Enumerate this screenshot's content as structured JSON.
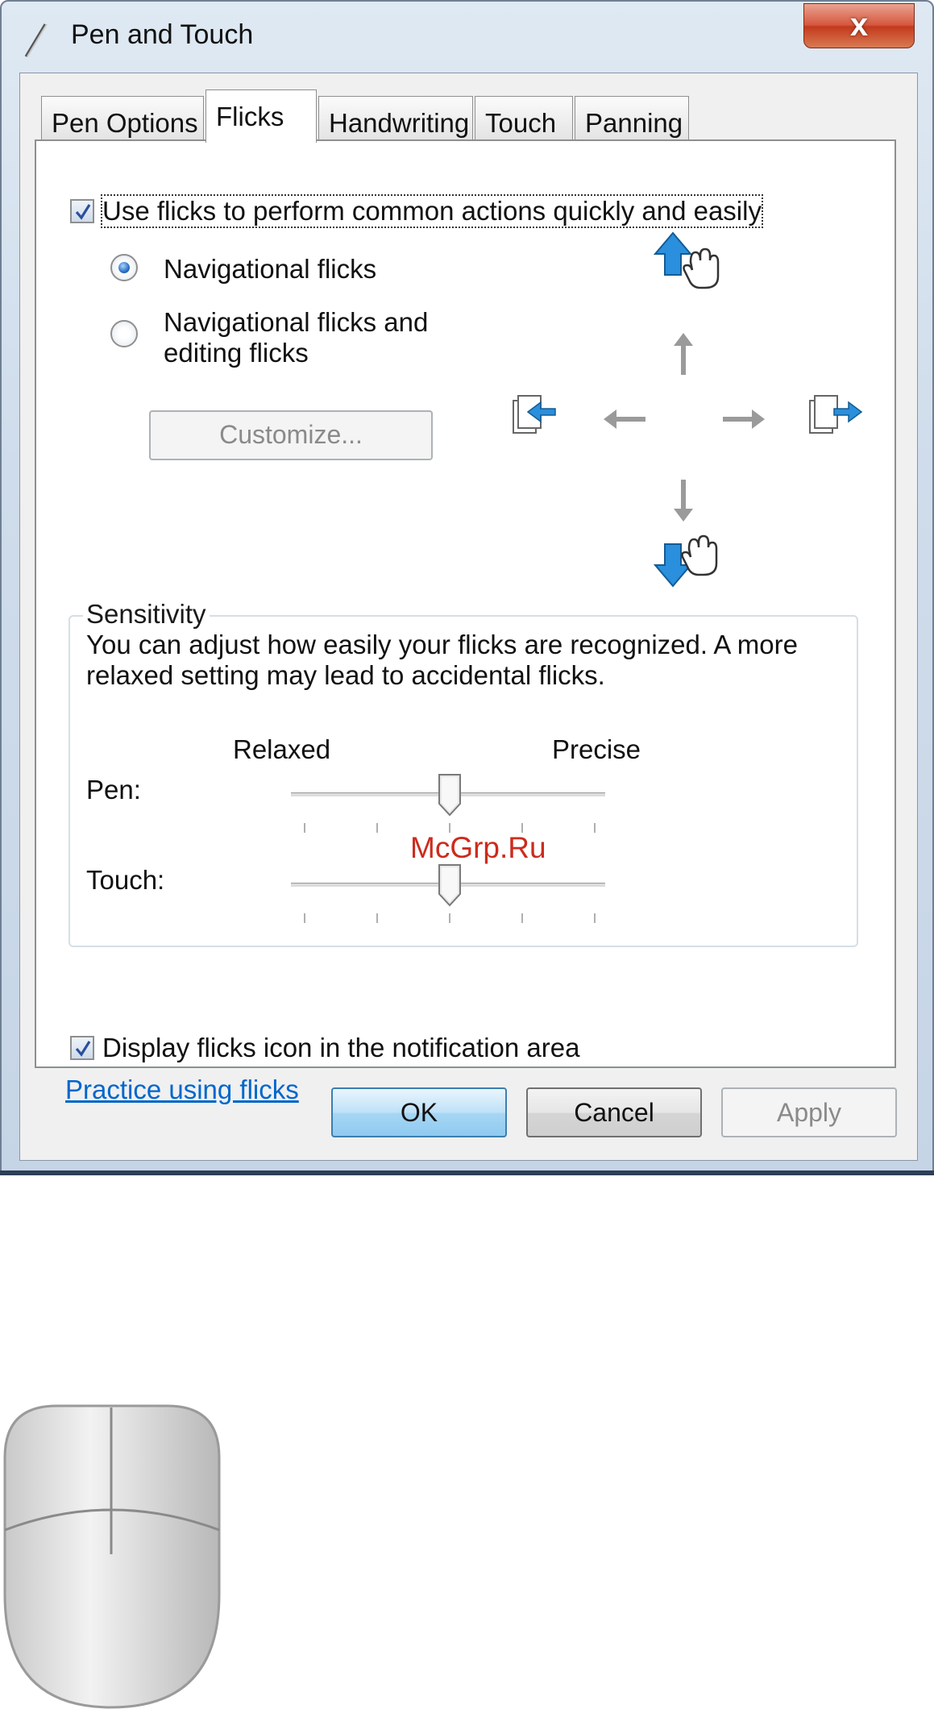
{
  "window": {
    "title": "Pen and Touch",
    "close_label": "x"
  },
  "tabs": [
    {
      "label": "Pen Options",
      "active": false
    },
    {
      "label": "Flicks",
      "active": true
    },
    {
      "label": "Handwriting",
      "active": false
    },
    {
      "label": "Touch",
      "active": false
    },
    {
      "label": "Panning",
      "active": false
    }
  ],
  "flicks": {
    "use_flicks": {
      "label": "Use flicks to perform common actions quickly and easily",
      "checked": true
    },
    "navigational": {
      "label": "Navigational flicks",
      "selected": true
    },
    "nav_editing": {
      "label_line1": "Navigational flicks and",
      "label_line2": "editing flicks",
      "selected": false
    },
    "customize_label": "Customize...",
    "customize_enabled": false
  },
  "sensitivity": {
    "title": "Sensitivity",
    "description_line1": "You can adjust how easily your flicks are recognized. A more",
    "description_line2": "relaxed setting may lead to accidental flicks.",
    "left_label": "Relaxed",
    "right_label": "Precise",
    "pen": {
      "label": "Pen:",
      "position": 3,
      "ticks": 5
    },
    "touch": {
      "label": "Touch:",
      "position": 3,
      "ticks": 5
    }
  },
  "notification": {
    "label": "Display flicks icon in the notification area",
    "checked": true
  },
  "practice_link": "Practice using flicks",
  "buttons": {
    "ok": "OK",
    "cancel": "Cancel",
    "apply": "Apply"
  },
  "watermark": "McGrp.Ru",
  "colors": {
    "accent": "#2a8fdc",
    "link": "#0066cc",
    "watermark": "#cc2b1d",
    "close": "#c33a1d"
  },
  "icons": {
    "app": "pen-icon",
    "flick_up": "flick-up-hand-icon",
    "flick_down": "flick-down-hand-icon",
    "back": "page-back-icon",
    "forward": "page-forward-icon",
    "extra": "mouse-icon"
  }
}
